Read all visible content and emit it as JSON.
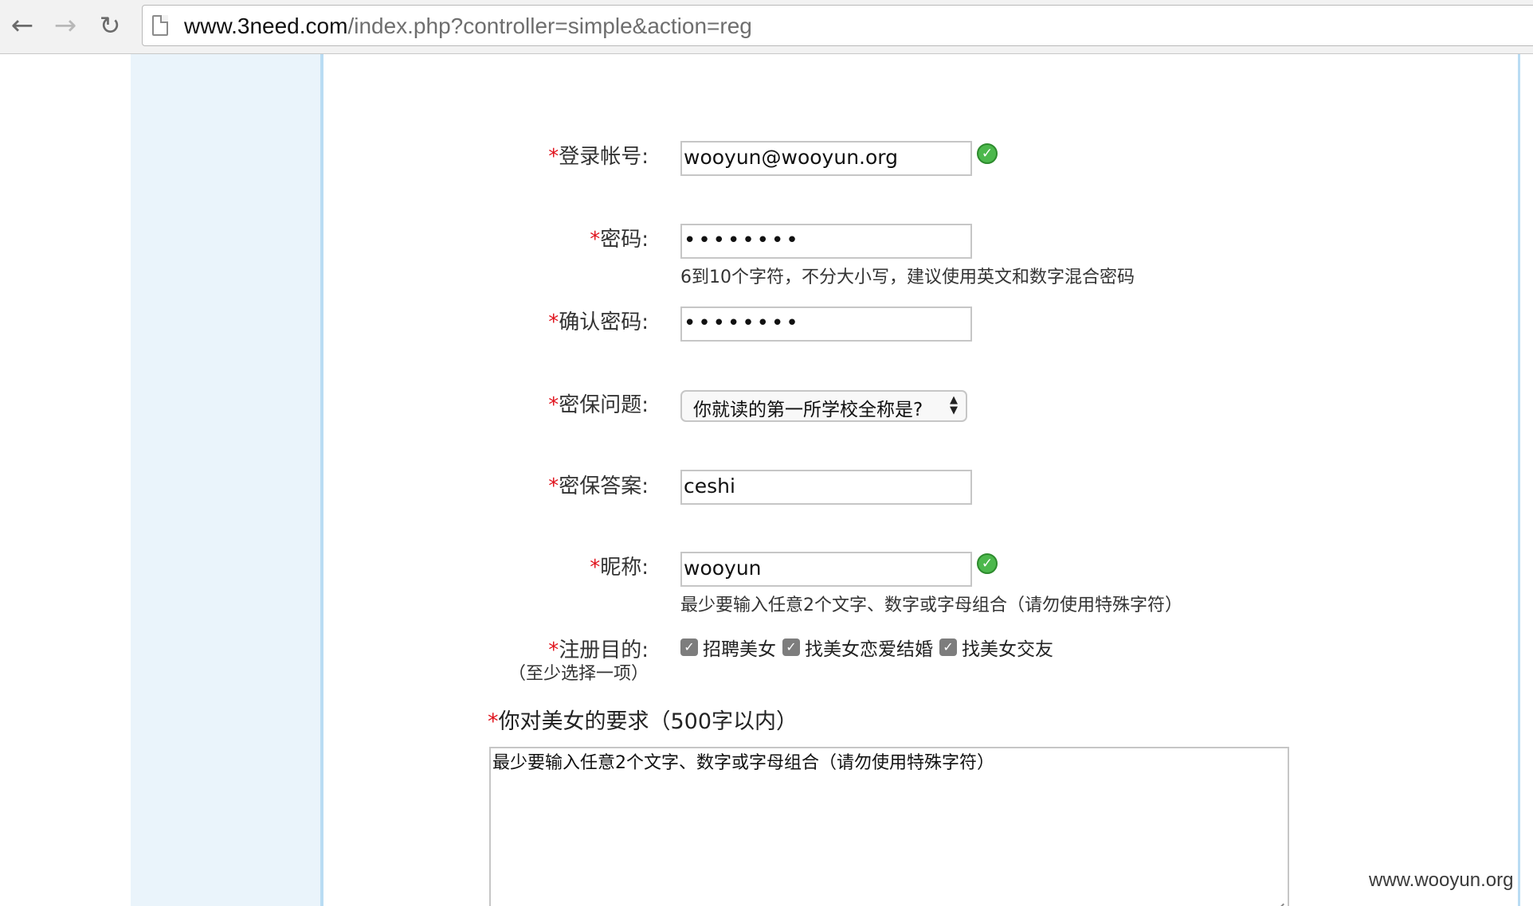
{
  "browser": {
    "url_host": "www.3need.com",
    "url_path": "/index.php?controller=simple&action=reg",
    "back_icon": "arrow-left-icon",
    "forward_icon": "arrow-right-icon",
    "reload_icon": "reload-icon"
  },
  "form": {
    "account": {
      "star": "*",
      "label": "登录帐号:",
      "value": "wooyun@wooyun.org",
      "valid": true
    },
    "password": {
      "star": "*",
      "label": "密码:",
      "value": "••••••••",
      "hint": "6到10个字符，不分大小写，建议使用英文和数字混合密码"
    },
    "confirm": {
      "star": "*",
      "label": "确认密码:",
      "value": "••••••••"
    },
    "question": {
      "star": "*",
      "label": "密保问题:",
      "selected": "你就读的第一所学校全称是?"
    },
    "answer": {
      "star": "*",
      "label": "密保答案:",
      "value": "ceshi"
    },
    "nickname": {
      "star": "*",
      "label": "昵称:",
      "value": "wooyun",
      "valid": true,
      "hint": "最少要输入任意2个文字、数字或字母组合（请勿使用特殊字符）"
    },
    "purpose": {
      "star": "*",
      "label": "注册目的:",
      "sublabel": "（至少选择一项）",
      "options": [
        {
          "label": "招聘美女",
          "checked": true
        },
        {
          "label": "找美女恋爱结婚",
          "checked": true
        },
        {
          "label": "找美女交友",
          "checked": true
        }
      ]
    },
    "requirements": {
      "star": "*",
      "label": "你对美女的要求（500字以内）",
      "value": "最少要输入任意2个文字、数字或字母组合（请勿使用特殊字符）"
    }
  },
  "watermark": "www.wooyun.org",
  "colors": {
    "required_star": "#e0141e",
    "left_panel": "#eaf4fb",
    "panel_border": "#b9dcf3",
    "check_ok": "#4cb84c"
  }
}
